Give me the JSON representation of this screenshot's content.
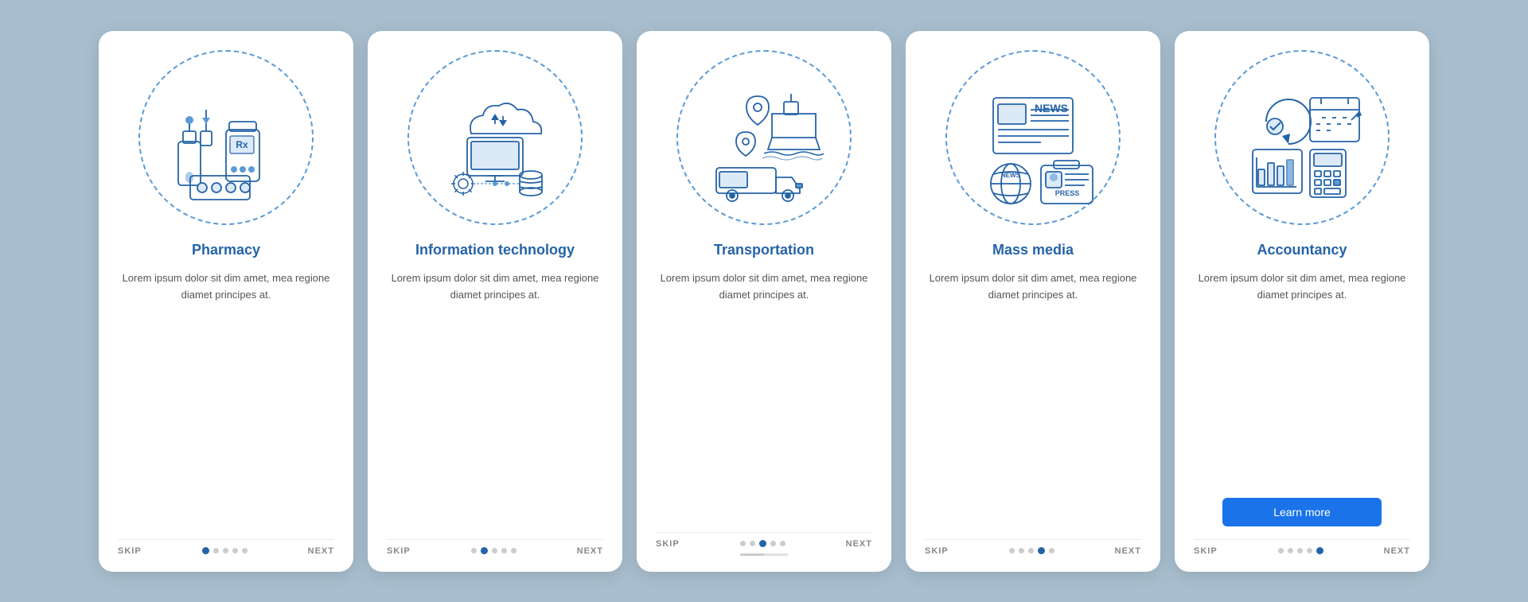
{
  "cards": [
    {
      "id": "pharmacy",
      "title": "Pharmacy",
      "body": "Lorem ipsum dolor sit dim amet, mea regione diamet principes at.",
      "dots": [
        1,
        0,
        0,
        0,
        0
      ],
      "active_dot": 0,
      "has_learn_more": false,
      "skip_label": "SKIP",
      "next_label": "NEXT"
    },
    {
      "id": "information-technology",
      "title": "Information technology",
      "body": "Lorem ipsum dolor sit dim amet, mea regione diamet principes at.",
      "dots": [
        0,
        1,
        0,
        0,
        0
      ],
      "active_dot": 1,
      "has_learn_more": false,
      "skip_label": "SKIP",
      "next_label": "NEXT"
    },
    {
      "id": "transportation",
      "title": "Transportation",
      "body": "Lorem ipsum dolor sit dim amet, mea regione diamet principes at.",
      "dots": [
        0,
        0,
        1,
        0,
        0
      ],
      "active_dot": 2,
      "has_learn_more": false,
      "skip_label": "SKIP",
      "next_label": "NEXT"
    },
    {
      "id": "mass-media",
      "title": "Mass media",
      "body": "Lorem ipsum dolor sit dim amet, mea regione diamet principes at.",
      "dots": [
        0,
        0,
        0,
        1,
        0
      ],
      "active_dot": 3,
      "has_learn_more": false,
      "skip_label": "SKIP",
      "next_label": "NEXT"
    },
    {
      "id": "accountancy",
      "title": "Accountancy",
      "body": "Lorem ipsum dolor sit dim amet, mea regione diamet principes at.",
      "dots": [
        0,
        0,
        0,
        0,
        1
      ],
      "active_dot": 4,
      "has_learn_more": true,
      "learn_more_label": "Learn more",
      "skip_label": "SKIP",
      "next_label": "NEXT"
    }
  ],
  "accent_color": "#2563a8",
  "button_color": "#1a73e8"
}
